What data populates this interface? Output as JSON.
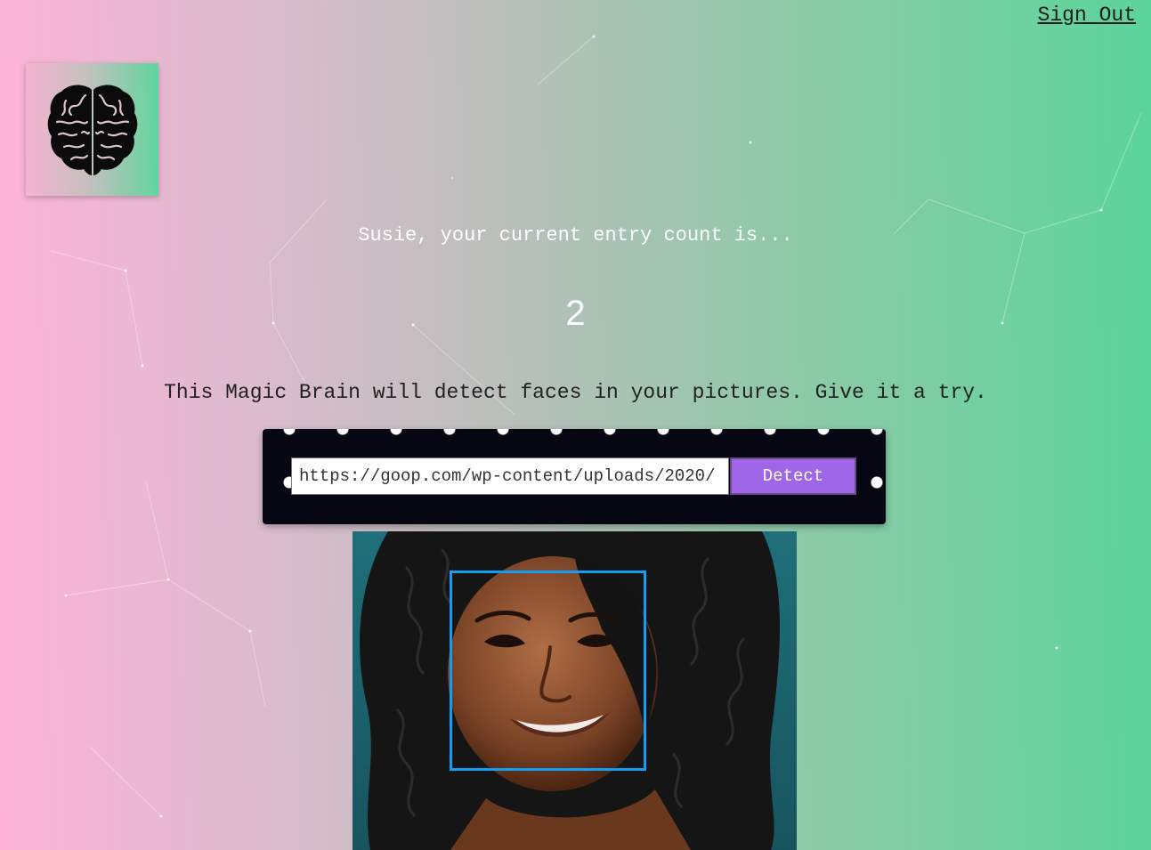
{
  "nav": {
    "signout_label": "Sign Out"
  },
  "logo": {
    "icon": "brain-icon"
  },
  "rank": {
    "message": "Susie, your current entry count is...",
    "count": "2"
  },
  "intro": {
    "text": "This Magic Brain will detect faces in your pictures. Give it a try."
  },
  "form": {
    "url_value": "https://goop.com/wp-content/uploads/2020/",
    "detect_label": "Detect"
  },
  "colors": {
    "background_start": "#fdb3d7",
    "background_end": "#5bd49b",
    "button": "#a066e8",
    "form_background": "#070714",
    "bounding_box": "#149df2"
  }
}
